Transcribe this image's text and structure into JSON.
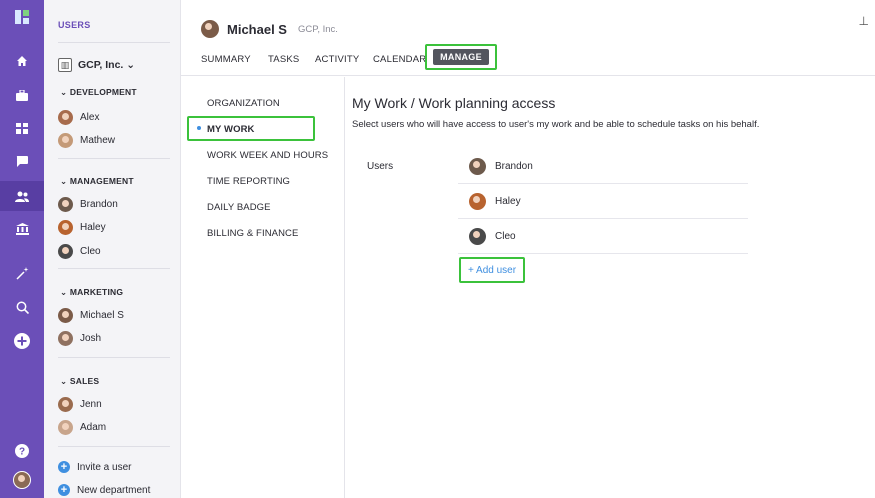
{
  "sidebar": {
    "title": "USERS",
    "org": "GCP, Inc. ⌄",
    "groups": [
      {
        "name": "⌄ DEVELOPMENT",
        "members": [
          "Alex",
          "Mathew"
        ]
      },
      {
        "name": "⌄ MANAGEMENT",
        "members": [
          "Brandon",
          "Haley",
          "Cleo"
        ]
      },
      {
        "name": "⌄ MARKETING",
        "members": [
          "Michael S",
          "Josh"
        ]
      },
      {
        "name": "⌄ SALES",
        "members": [
          "Jenn",
          "Adam"
        ]
      }
    ],
    "actions": {
      "invite": "Invite a user",
      "new_department": "New department"
    }
  },
  "header": {
    "user_name": "Michael S",
    "company": "GCP, Inc.",
    "tabs": [
      "SUMMARY",
      "TASKS",
      "ACTIVITY",
      "CALENDAR",
      "MANAGE"
    ],
    "active_tab": "MANAGE"
  },
  "manage_nav": [
    "ORGANIZATION",
    "MY WORK",
    "WORK WEEK AND HOURS",
    "TIME REPORTING",
    "DAILY BADGE",
    "BILLING & FINANCE"
  ],
  "content": {
    "title": "My Work / Work planning access",
    "description": "Select users who will have access to user's my work and be able to schedule tasks on his behalf.",
    "users_label": "Users",
    "users": [
      "Brandon",
      "Haley",
      "Cleo"
    ],
    "add_user": "+ Add user"
  },
  "icons": {
    "rail": [
      "logo-icon",
      "home-icon",
      "briefcase-icon",
      "dashboard-icon",
      "chat-icon",
      "users-icon",
      "bank-icon",
      "magic-wand-icon",
      "search-icon",
      "add-icon",
      "help-icon",
      "profile-avatar"
    ],
    "pin": "pin-icon"
  },
  "colors": {
    "rail": "#6b4fb8",
    "rail_active": "#583ea3",
    "highlight": "#3bc23b",
    "link": "#3f8fe0",
    "tab_pill": "#53555e"
  }
}
